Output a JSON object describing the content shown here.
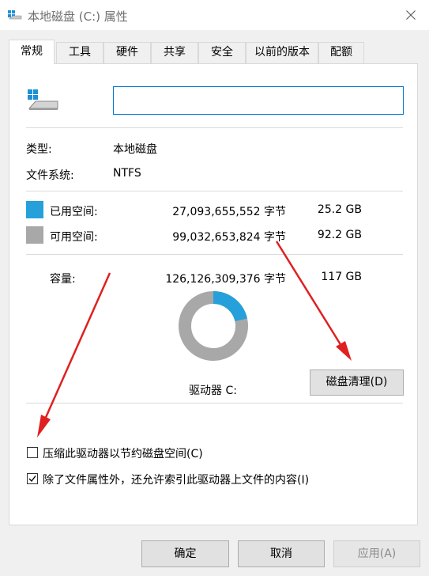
{
  "window": {
    "title": "本地磁盘 (C:) 属性",
    "close_icon": "close-icon"
  },
  "tabs": [
    {
      "label": "常规",
      "active": true
    },
    {
      "label": "工具"
    },
    {
      "label": "硬件"
    },
    {
      "label": "共享"
    },
    {
      "label": "安全"
    },
    {
      "label": "以前的版本"
    },
    {
      "label": "配额"
    }
  ],
  "general": {
    "volume_name_value": "",
    "type_label": "类型:",
    "type_value": "本地磁盘",
    "fs_label": "文件系统:",
    "fs_value": "NTFS",
    "used": {
      "label": "已用空间:",
      "bytes": "27,093,655,552 字节",
      "size": "25.2 GB",
      "color": "#26a0da"
    },
    "free": {
      "label": "可用空间:",
      "bytes": "99,032,653,824 字节",
      "size": "92.2 GB",
      "color": "#a8a8a8"
    },
    "capacity": {
      "label": "容量:",
      "bytes": "126,126,309,376 字节",
      "size": "117 GB"
    },
    "used_fraction": 0.2148,
    "drive_label": "驱动器 C:",
    "cleanup_button": "磁盘清理(D)",
    "compress_checkbox": {
      "label": "压缩此驱动器以节约磁盘空间(C)",
      "checked": false
    },
    "index_checkbox": {
      "label": "除了文件属性外，还允许索引此驱动器上文件的内容(I)",
      "checked": true
    }
  },
  "buttons": {
    "ok": "确定",
    "cancel": "取消",
    "apply": "应用(A)"
  },
  "annotation_color": "#e02020"
}
